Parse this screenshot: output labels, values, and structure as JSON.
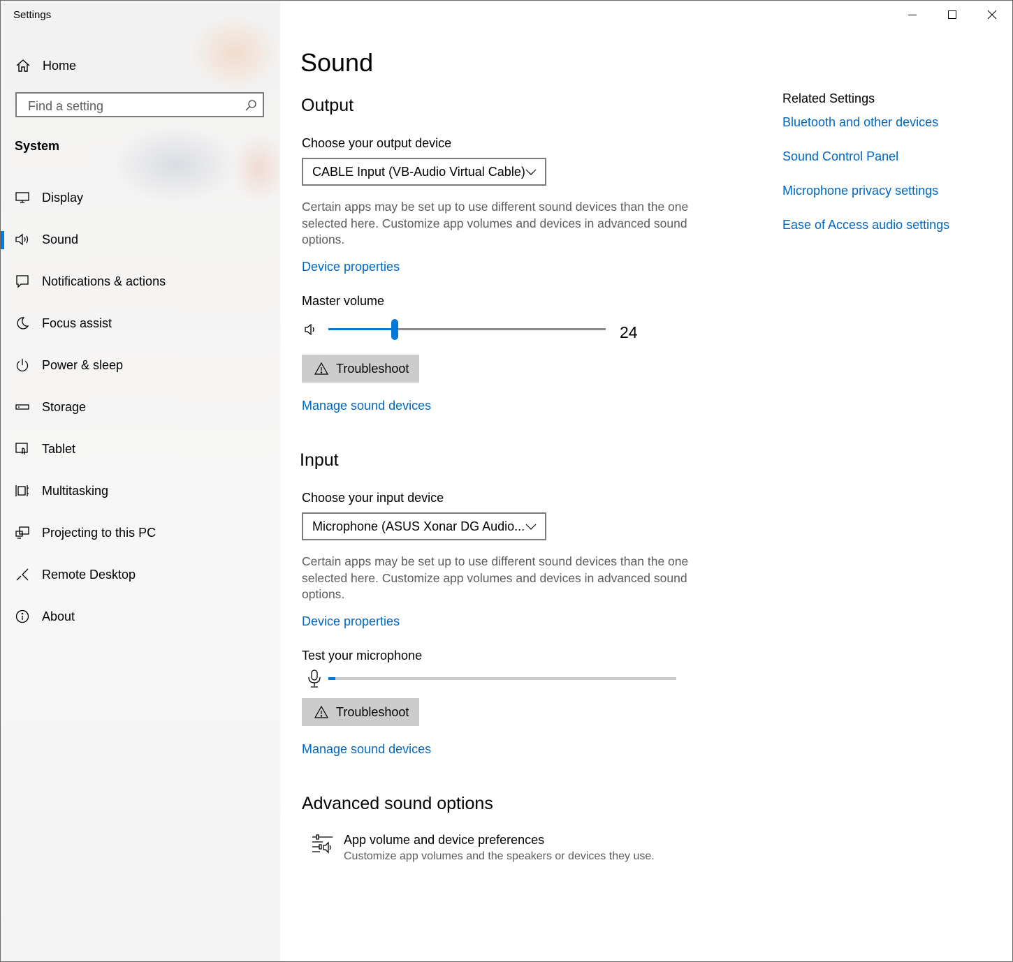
{
  "window": {
    "title": "Settings"
  },
  "sidebar": {
    "home_label": "Home",
    "search_placeholder": "Find a setting",
    "section_label": "System",
    "items": [
      {
        "label": "Display",
        "icon": "display-icon"
      },
      {
        "label": "Sound",
        "icon": "speaker-icon",
        "active": true
      },
      {
        "label": "Notifications & actions",
        "icon": "notification-icon"
      },
      {
        "label": "Focus assist",
        "icon": "moon-icon"
      },
      {
        "label": "Power & sleep",
        "icon": "power-icon"
      },
      {
        "label": "Storage",
        "icon": "storage-icon"
      },
      {
        "label": "Tablet",
        "icon": "tablet-icon"
      },
      {
        "label": "Multitasking",
        "icon": "multitasking-icon"
      },
      {
        "label": "Projecting to this PC",
        "icon": "projecting-icon"
      },
      {
        "label": "Remote Desktop",
        "icon": "remote-desktop-icon"
      },
      {
        "label": "About",
        "icon": "info-icon"
      }
    ]
  },
  "main": {
    "title": "Sound",
    "output": {
      "heading": "Output",
      "device_label": "Choose your output device",
      "device_value": "CABLE Input (VB-Audio Virtual Cable)",
      "description": "Certain apps may be set up to use different sound devices than the one selected here. Customize app volumes and devices in advanced sound options.",
      "device_properties": "Device properties",
      "volume_label": "Master volume",
      "volume_value": 24,
      "volume_text": "24",
      "troubleshoot": "Troubleshoot",
      "manage_devices": "Manage sound devices"
    },
    "input": {
      "heading": "Input",
      "device_label": "Choose your input device",
      "device_value": "Microphone (ASUS Xonar DG Audio...",
      "description": "Certain apps may be set up to use different sound devices than the one selected here. Customize app volumes and devices in advanced sound options.",
      "device_properties": "Device properties",
      "test_label": "Test your microphone",
      "mic_level": 2,
      "troubleshoot": "Troubleshoot",
      "manage_devices": "Manage sound devices"
    },
    "advanced": {
      "heading": "Advanced sound options",
      "item_title": "App volume and device preferences",
      "item_desc": "Customize app volumes and the speakers or devices they use."
    }
  },
  "related": {
    "title": "Related Settings",
    "links": [
      "Bluetooth and other devices",
      "Sound Control Panel",
      "Microphone privacy settings",
      "Ease of Access audio settings"
    ]
  },
  "colors": {
    "accent": "#0078d7",
    "link": "#0067c0"
  }
}
